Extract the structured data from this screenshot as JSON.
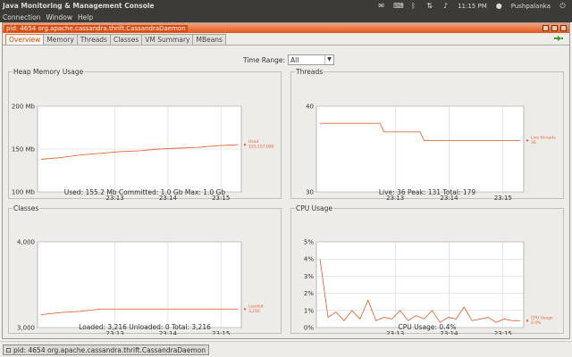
{
  "system": {
    "app_title": "Java Monitoring & Management Console",
    "clock": "11:15 PM",
    "user": "Pushpalanka"
  },
  "menu": [
    "Connection",
    "Window",
    "Help"
  ],
  "frame": {
    "title": "pid: 4654 org.apache.cassandra.thrift.CassandraDaemon"
  },
  "tabs": [
    "Overview",
    "Memory",
    "Threads",
    "Classes",
    "VM Summary",
    "MBeans"
  ],
  "time_range": {
    "label": "Time Range:",
    "value": "All"
  },
  "panels": {
    "heap": {
      "title": "Heap Memory Usage",
      "summary": "Used: 155.2 Mb    Committed: 1.0 Gb    Max: 1.0 Gb"
    },
    "threads": {
      "title": "Threads",
      "summary": "Live: 36    Peak: 131    Total: 179"
    },
    "classes": {
      "title": "Classes",
      "summary": "Loaded: 3,216    Unloaded: 0    Total: 3,216"
    },
    "cpu": {
      "title": "CPU Usage",
      "summary": "CPU Usage: 0.4%"
    }
  },
  "status_task": "pid: 4654 org.apache.cassandra.thrift.CassandraDaemon",
  "colors": {
    "series": "#e06a3a",
    "grid": "#cfcfcf",
    "accent": "#e2581c",
    "panel_bg": "#3c3b37"
  },
  "chart_data": [
    {
      "type": "line",
      "title": "Heap Memory Usage",
      "x_ticks": [
        "23:13",
        "23:14",
        "23:15"
      ],
      "y_ticks": [
        "200 Mb",
        "150 Mb",
        "100 Mb"
      ],
      "ylim": [
        100,
        200
      ],
      "series": [
        {
          "name": "Used",
          "legend_value": "155,157,080",
          "x": [
            0,
            1,
            2,
            3,
            4,
            5,
            6,
            7,
            8,
            9,
            10
          ],
          "y": [
            138,
            140,
            143,
            145,
            147,
            148,
            150,
            151,
            152,
            154,
            155
          ]
        }
      ],
      "grid": true,
      "legend": "right"
    },
    {
      "type": "line",
      "title": "Threads",
      "x_ticks": [
        "23:13",
        "23:14",
        "23:15"
      ],
      "y_ticks": [
        "40",
        "30"
      ],
      "ylim": [
        30,
        40
      ],
      "series": [
        {
          "name": "Live threads",
          "legend_value": "36",
          "x": [
            0,
            3,
            3.2,
            5,
            5.2,
            10
          ],
          "y": [
            38,
            38,
            37,
            37,
            36,
            36
          ]
        }
      ],
      "grid": true,
      "legend": "right"
    },
    {
      "type": "line",
      "title": "Classes",
      "x_ticks": [
        "23:13",
        "23:14",
        "23:15"
      ],
      "y_ticks": [
        "4,000",
        "3,000"
      ],
      "ylim": [
        3000,
        4000
      ],
      "series": [
        {
          "name": "Loaded",
          "legend_value": "3,216",
          "x": [
            0,
            1,
            2,
            3,
            10
          ],
          "y": [
            3150,
            3175,
            3190,
            3216,
            3216
          ]
        }
      ],
      "grid": true,
      "legend": "right"
    },
    {
      "type": "line",
      "title": "CPU Usage",
      "x_ticks": [
        "23:13",
        "23:14",
        "23:15"
      ],
      "y_ticks": [
        "5%",
        "4%",
        "3%",
        "2%",
        "1%",
        "0%"
      ],
      "ylim": [
        0,
        5
      ],
      "series": [
        {
          "name": "CPU Usage",
          "legend_value": "0.4%",
          "x": [
            0,
            0.4,
            0.8,
            1.2,
            1.6,
            2,
            2.4,
            2.8,
            3.2,
            3.6,
            4,
            4.4,
            4.8,
            5.2,
            5.6,
            6,
            6.4,
            6.8,
            7.2,
            7.6,
            8,
            8.4,
            8.8,
            9.2,
            9.6,
            10
          ],
          "y": [
            4.0,
            0.6,
            0.9,
            0.4,
            1.0,
            0.5,
            1.6,
            0.4,
            0.6,
            0.5,
            1.0,
            0.4,
            0.7,
            0.5,
            1.0,
            0.3,
            0.6,
            0.5,
            1.2,
            0.4,
            0.5,
            0.6,
            0.3,
            0.5,
            0.4,
            0.4
          ]
        }
      ],
      "grid": true,
      "legend": "right"
    }
  ]
}
